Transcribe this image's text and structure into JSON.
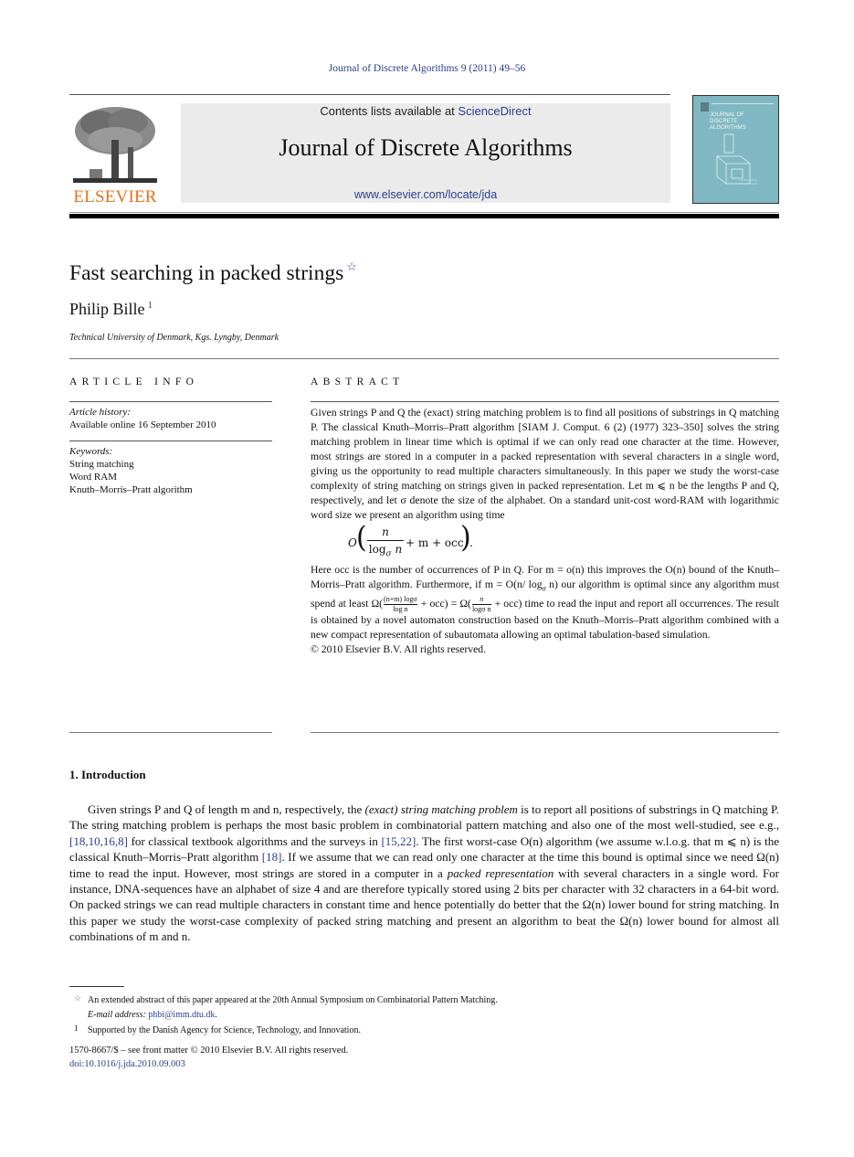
{
  "header": {
    "running_head": "Journal of Discrete Algorithms 9 (2011) 49–56",
    "publisher_name": "ELSEVIER",
    "contents_prefix": "Contents lists available at ",
    "contents_link": "ScienceDirect",
    "journal_title": "Journal of Discrete Algorithms",
    "journal_url": "www.elsevier.com/locate/jda",
    "cover_title_lines": [
      "JOURNAL OF",
      "DISCRETE",
      "ALGORITHMS"
    ],
    "colors": {
      "link": "#2a3e8f",
      "elsevier_orange": "#e8711c",
      "cover": "#7fb8c3",
      "masthead_bg": "#ebebeb"
    }
  },
  "article": {
    "title": "Fast searching in packed strings",
    "title_note_mark": "☆",
    "author": "Philip Bille",
    "author_note_mark": "1",
    "affiliation": "Technical University of Denmark, Kgs. Lyngby, Denmark"
  },
  "article_info": {
    "heading": "ARTICLE INFO",
    "history_label": "Article history:",
    "history_value": "Available online 16 September 2010",
    "keywords_label": "Keywords:",
    "keywords": [
      "String matching",
      "Word RAM",
      "Knuth–Morris–Pratt algorithm"
    ]
  },
  "abstract": {
    "heading": "ABSTRACT",
    "para1": "Given strings P and Q the (exact) string matching problem is to find all positions of substrings in Q matching P. The classical Knuth–Morris–Pratt algorithm [SIAM J. Comput. 6 (2) (1977) 323–350] solves the string matching problem in linear time which is optimal if we can only read one character at the time. However, most strings are stored in a computer in a packed representation with several characters in a single word, giving us the opportunity to read multiple characters simultaneously. In this paper we study the worst-case complexity of string matching on strings given in packed representation. Let m ⩽ n be the lengths P and Q, respectively, and let σ denote the size of the alphabet. On a standard unit-cost word-RAM with logarithmic word size we present an algorithm using time",
    "formula": {
      "outer": "O",
      "numerator": "n",
      "denominator": "log",
      "denominator_sub": "σ",
      "denominator_var": "n",
      "rest": "+ m + occ",
      "end": "."
    },
    "para2_a": "Here occ is the number of occurrences of P in Q. For m = o(n) this improves the O(n) bound of the Knuth–Morris–Pratt algorithm. Furthermore, if m = O(n/ log",
    "para2_sub": "σ",
    "para2_b": " n) our algorithm is optimal since any algorithm must spend at least Ω(",
    "para2_frac1_num": "(n+m) logσ",
    "para2_frac1_den": "log n",
    "para2_c": " + occ) = Ω(",
    "para2_frac2_num": "n",
    "para2_frac2_den": "logσ n",
    "para2_d": " + occ) time to read the input and report all occurrences. The result is obtained by a novel automaton construction based on the Knuth–Morris–Pratt algorithm combined with a new compact representation of subautomata allowing an optimal tabulation-based simulation.",
    "copyright": "© 2010 Elsevier B.V. All rights reserved."
  },
  "introduction": {
    "heading": "1. Introduction",
    "s1": "Given strings P and Q of length m and n, respectively, the ",
    "s1_italic": "(exact) string matching problem",
    "s2": " is to report all positions of substrings in Q matching P. The string matching problem is perhaps the most basic problem in combinatorial pattern matching and also one of the most well-studied, see e.g., ",
    "ref1": "[18,10,16,8]",
    "s3": " for classical textbook algorithms and the surveys in ",
    "ref2": "[15,22]",
    "s4": ". The first worst-case O(n) algorithm (we assume w.l.o.g. that m ⩽ n) is the classical Knuth–Morris–Pratt algorithm ",
    "ref3": "[18]",
    "s5": ". If we assume that we can read only one character at the time this bound is optimal since we need Ω(n) time to read the input. However, most strings are stored in a computer in a ",
    "s5_italic": "packed representation",
    "s6": " with several characters in a single word. For instance, DNA-sequences have an alphabet of size 4 and are therefore typically stored using 2 bits per character with 32 characters in a 64-bit word. On packed strings we can read multiple characters in constant time and hence potentially do better that the Ω(n) lower bound for string matching. In this paper we study the worst-case complexity of packed string matching and present an algorithm to beat the Ω(n) lower bound for almost all combinations of m and n."
  },
  "footnotes": [
    {
      "mark": "☆",
      "text": "An extended abstract of this paper appeared at the 20th Annual Symposium on Combinatorial Pattern Matching."
    },
    {
      "mark": "",
      "label": "E-mail address: ",
      "link": "phbi@imm.dtu.dk",
      "after": "."
    },
    {
      "mark": "1",
      "text": "Supported by the Danish Agency for Science, Technology, and Innovation."
    }
  ],
  "front_matter": {
    "issn_line": "1570-8667/$ – see front matter  © 2010 Elsevier B.V. All rights reserved.",
    "doi": "doi:10.1016/j.jda.2010.09.003"
  }
}
